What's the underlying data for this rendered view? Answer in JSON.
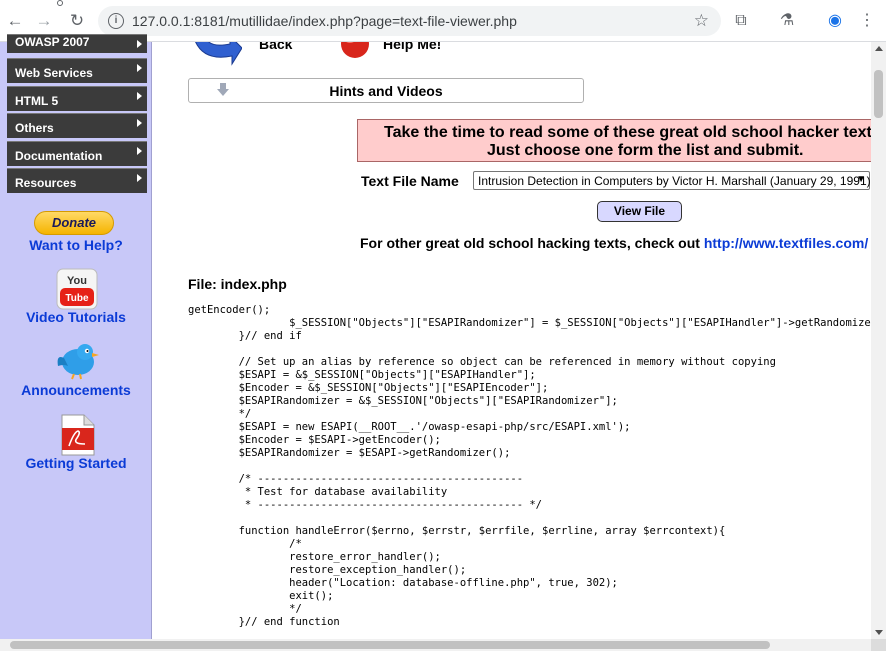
{
  "browser": {
    "url": "127.0.0.1:8181/mutillidae/index.php?page=text-file-viewer.php",
    "back_glyph": "←",
    "forward_glyph": "→",
    "reload_glyph": "↻",
    "star_glyph": "☆",
    "extensions_glyph": "⧉",
    "labs_glyph": "⚗",
    "profile_glyph": "◉",
    "menu_glyph": "⋮"
  },
  "sidebar": {
    "items": [
      {
        "label": "OWASP 2007"
      },
      {
        "label": "Web Services"
      },
      {
        "label": "HTML 5"
      },
      {
        "label": "Others"
      },
      {
        "label": "Documentation"
      },
      {
        "label": "Resources"
      }
    ],
    "donate_label": "Donate",
    "help_link": "Want to Help?",
    "youtube_text": "You Tube",
    "video_link": "Video Tutorials",
    "announcements_link": "Announcements",
    "getting_started_link": "Getting Started"
  },
  "main": {
    "back_label": "Back",
    "help_label": "Help Me!",
    "hints_label": "Hints and Videos",
    "banner_line1": "Take the time to read some of these great old school hacker text fil",
    "banner_line2": "Just choose one form the list and submit.",
    "text_file_label": "Text File Name",
    "selected_file": "Intrusion Detection in Computers by Victor H. Marshall (January 29, 1991)",
    "view_button": "View File",
    "other_text": "For other great old school hacking texts, check out ",
    "other_link": "http://www.textfiles.com/",
    "other_suffix": " .",
    "file_heading": "File: index.php",
    "code_lines": [
      "getEncoder();",
      "\t\t$_SESSION[\"Objects\"][\"ESAPIRandomizer\"] = $_SESSION[\"Objects\"][\"ESAPIHandler\"]->getRandomizer();",
      "\t}// end if",
      "",
      "\t// Set up an alias by reference so object can be referenced in memory without copying",
      "\t$ESAPI = &$_SESSION[\"Objects\"][\"ESAPIHandler\"];",
      "\t$Encoder = &$_SESSION[\"Objects\"][\"ESAPIEncoder\"];",
      "\t$ESAPIRandomizer = &$_SESSION[\"Objects\"][\"ESAPIRandomizer\"];",
      "\t*/",
      "\t$ESAPI = new ESAPI(__ROOT__.'/owasp-esapi-php/src/ESAPI.xml');",
      "\t$Encoder = $ESAPI->getEncoder();",
      "\t$ESAPIRandomizer = $ESAPI->getRandomizer();",
      "",
      "\t/* ------------------------------------------",
      "\t * Test for database availability",
      "\t * ------------------------------------------ */",
      "",
      "\tfunction handleError($errno, $errstr, $errfile, $errline, array $errcontext){",
      "\t\t/*",
      "\t\trestore_error_handler();",
      "\t\trestore_exception_handler();",
      "\t\theader(\"Location: database-offline.php\", true, 302);",
      "\t\texit();",
      "\t\t*/",
      "\t}// end function"
    ]
  }
}
